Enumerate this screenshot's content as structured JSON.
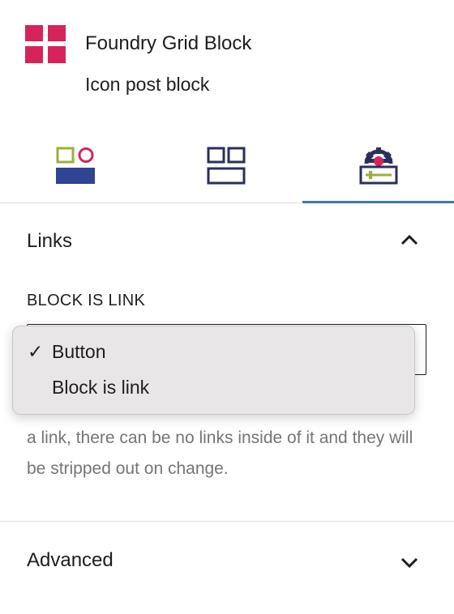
{
  "block": {
    "title": "Foundry Grid Block",
    "description": "Icon post block",
    "icon": "grid-block-icon",
    "icon_color": "#d6245a"
  },
  "tabs": [
    {
      "name": "styles-tab",
      "icon": "styles-icon"
    },
    {
      "name": "layout-tab",
      "icon": "layout-icon"
    },
    {
      "name": "settings-tab",
      "icon": "settings-icon",
      "active": true
    }
  ],
  "accent_color": "#3b77b4",
  "links_panel": {
    "title": "Links",
    "expanded": true,
    "field_label": "BLOCK IS LINK",
    "select": {
      "selected": "Button",
      "options": [
        "Button",
        "Block is link"
      ]
    },
    "help_text": "a link, there can be no links inside of it and they will be stripped out on change."
  },
  "advanced_panel": {
    "title": "Advanced",
    "expanded": false
  }
}
